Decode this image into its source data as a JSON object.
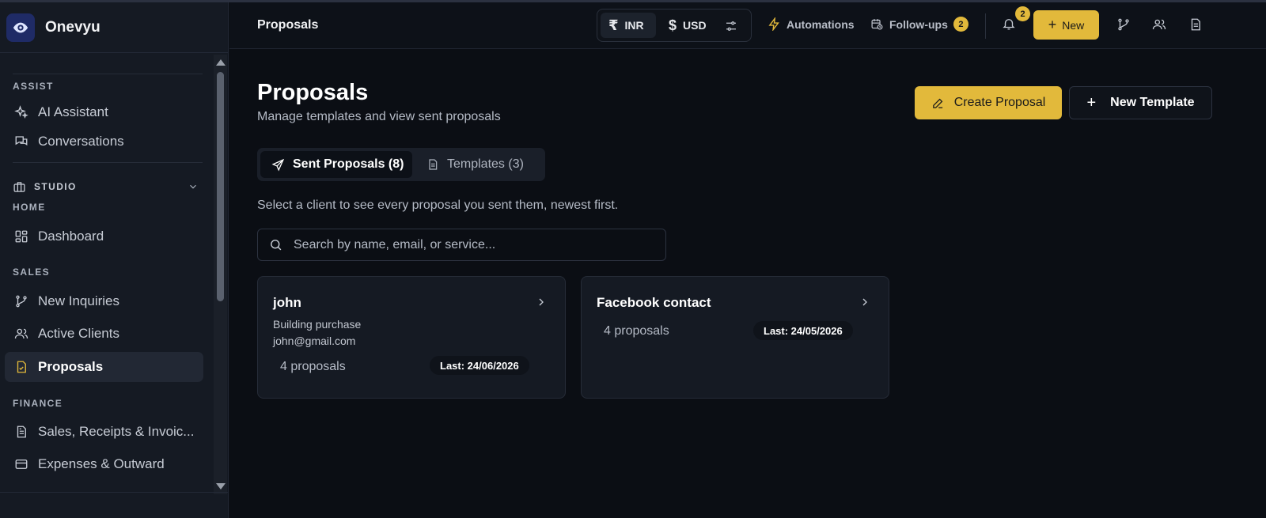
{
  "app": {
    "name": "Onevyu"
  },
  "sidebar": {
    "sections": {
      "assist": "ASSIST",
      "studio": "STUDIO",
      "home": "HOME",
      "sales": "SALES",
      "finance": "FINANCE"
    },
    "items": [
      {
        "label": "AI Assistant",
        "icon": "sparkles-icon"
      },
      {
        "label": "Conversations",
        "icon": "chat-icon"
      },
      {
        "label": "Dashboard",
        "icon": "grid-icon"
      },
      {
        "label": "New Inquiries",
        "icon": "branch-icon"
      },
      {
        "label": "Active Clients",
        "icon": "users-icon"
      },
      {
        "label": "Proposals",
        "icon": "document-check-icon",
        "active": true
      },
      {
        "label": "Sales, Receipts & Invoic...",
        "icon": "document-icon"
      },
      {
        "label": "Expenses & Outward",
        "icon": "card-icon"
      }
    ]
  },
  "topbar": {
    "title": "Proposals",
    "currency": {
      "inr": "INR",
      "usd": "USD",
      "inr_symbol": "₹",
      "usd_symbol": "$"
    },
    "automations": "Automations",
    "followups": "Follow-ups",
    "followups_count": "2",
    "notifications_count": "2",
    "new_label": "New"
  },
  "main": {
    "title": "Proposals",
    "subtitle": "Manage templates and view sent proposals",
    "create_proposal": "Create Proposal",
    "new_template": "New Template",
    "tabs": [
      {
        "label": "Sent Proposals (8)",
        "active": true
      },
      {
        "label": "Templates (3)",
        "active": false
      }
    ],
    "hint": "Select a client to see every proposal you sent them, newest first.",
    "search_placeholder": "Search by name, email, or service...",
    "clients": [
      {
        "name": "john",
        "service": "Building purchase",
        "email": "john@gmail.com",
        "count": "4 proposals",
        "last": "Last: 24/06/2026"
      },
      {
        "name": "Facebook contact",
        "count": "4 proposals",
        "last": "Last: 24/05/2026"
      }
    ]
  },
  "colors": {
    "accent": "#e2b93b",
    "background": "#0b0e14",
    "sidebar": "#151a23"
  }
}
